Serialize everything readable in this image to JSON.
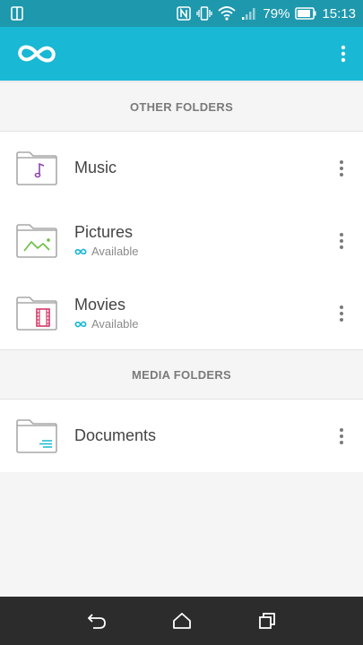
{
  "status_bar": {
    "battery_percent": "79%",
    "time": "15:13",
    "icons": [
      "screen-mirror-icon",
      "nfc-icon",
      "vibrate-icon",
      "wifi-icon",
      "signal-icon",
      "battery-icon"
    ]
  },
  "app_bar": {
    "logo_icon": "infinity-logo-icon",
    "menu_icon": "overflow-menu-icon"
  },
  "sections": [
    {
      "title": "OTHER FOLDERS",
      "folders": [
        {
          "name": "Music",
          "status": "",
          "icon": "folder-music-icon"
        },
        {
          "name": "Pictures",
          "status": "Available",
          "icon": "folder-pictures-icon"
        },
        {
          "name": "Movies",
          "status": "Available",
          "icon": "folder-movies-icon"
        }
      ]
    },
    {
      "title": "MEDIA FOLDERS",
      "folders": [
        {
          "name": "Documents",
          "status": "",
          "icon": "folder-documents-icon"
        }
      ]
    }
  ],
  "nav_bar": {
    "icons": [
      "back-icon",
      "home-icon",
      "recents-icon"
    ]
  },
  "colors": {
    "status_bar": "#1e98ad",
    "app_bar": "#19b8d4",
    "music_accent": "#8e44ad",
    "pictures_accent": "#6abf40",
    "movies_accent": "#d23a6a",
    "documents_accent": "#19b8d4",
    "available_icon": "#19b8d4"
  }
}
